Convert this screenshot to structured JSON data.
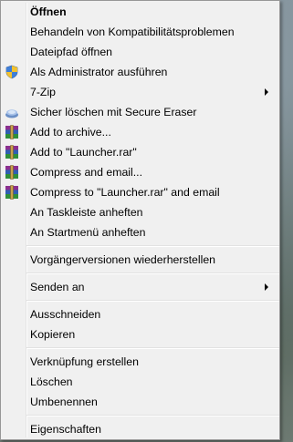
{
  "context_menu": {
    "items": [
      {
        "label": "Öffnen"
      },
      {
        "label": "Behandeln von Kompatibilitätsproblemen"
      },
      {
        "label": "Dateipfad öffnen"
      },
      {
        "label": "Als Administrator ausführen",
        "icon": "uac-shield-icon"
      },
      {
        "label": "7-Zip"
      },
      {
        "label": "Sicher löschen mit Secure Eraser",
        "icon": "secure-eraser-icon"
      },
      {
        "label": "Add to archive...",
        "icon": "winrar-icon"
      },
      {
        "label": "Add to \"Launcher.rar\"",
        "icon": "winrar-icon"
      },
      {
        "label": "Compress and email...",
        "icon": "winrar-icon"
      },
      {
        "label": "Compress to \"Launcher.rar\" and email",
        "icon": "winrar-icon"
      },
      {
        "label": "An Taskleiste anheften"
      },
      {
        "label": "An Startmenü anheften"
      },
      {
        "label": "Vorgängerversionen wiederherstellen"
      },
      {
        "label": "Senden an"
      },
      {
        "label": "Ausschneiden"
      },
      {
        "label": "Kopieren"
      },
      {
        "label": "Verknüpfung erstellen"
      },
      {
        "label": "Löschen"
      },
      {
        "label": "Umbenennen"
      },
      {
        "label": "Eigenschaften"
      }
    ]
  }
}
